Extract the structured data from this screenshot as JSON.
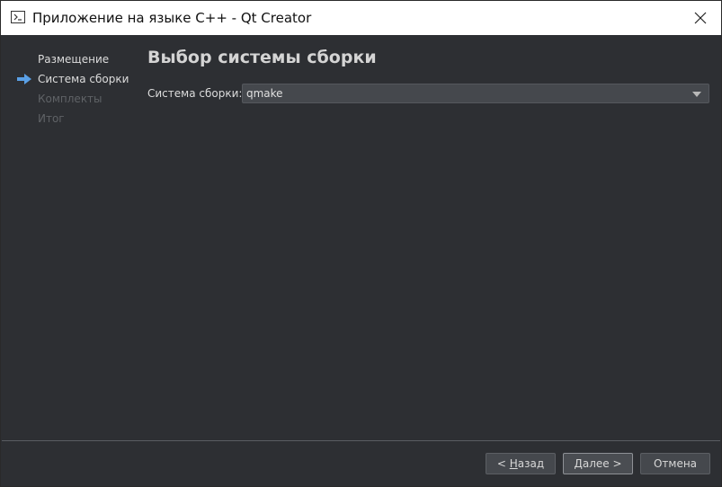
{
  "window": {
    "title": "Приложение на языке C++ - Qt Creator"
  },
  "steps": [
    {
      "label": "Размещение",
      "state": "done"
    },
    {
      "label": "Система сборки",
      "state": "current"
    },
    {
      "label": "Комплекты",
      "state": "disabled"
    },
    {
      "label": "Итог",
      "state": "disabled"
    }
  ],
  "page": {
    "title": "Выбор системы сборки",
    "build_system_label": "Система сборки:",
    "build_system_value": "qmake"
  },
  "buttons": {
    "back_prefix": "< ",
    "back_mnemonic": "Н",
    "back_rest": "азад",
    "next_mnemonic": "Д",
    "next_rest": "алее >",
    "cancel": "Отмена"
  },
  "colors": {
    "background": "#2d2f33",
    "current_step_arrow": "#5aa0e6"
  }
}
